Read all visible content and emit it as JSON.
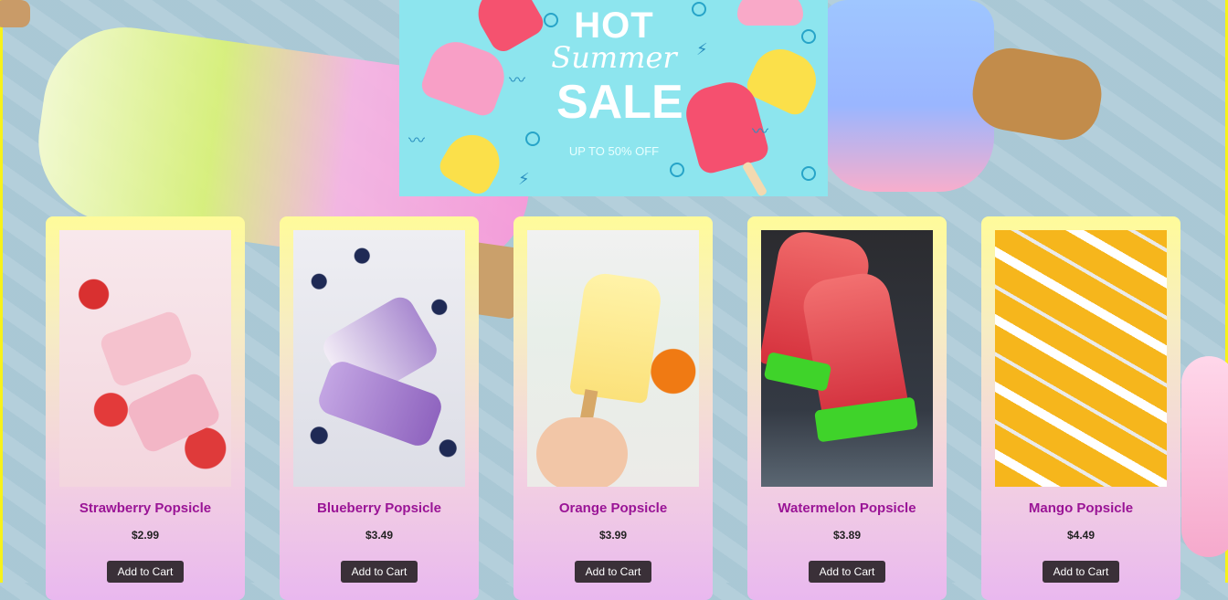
{
  "banner": {
    "title_hot": "HOT",
    "title_summer": "Summer",
    "title_sale": "SALE",
    "subtitle": "UP TO 50% OFF"
  },
  "products": [
    {
      "name": "Strawberry Popsicle",
      "price": "$2.99",
      "button": "Add to Cart",
      "image": "strawberry-popsicles-photo"
    },
    {
      "name": "Blueberry Popsicle",
      "price": "$3.49",
      "button": "Add to Cart",
      "image": "blueberry-popsicles-photo"
    },
    {
      "name": "Orange Popsicle",
      "price": "$3.99",
      "button": "Add to Cart",
      "image": "orange-popsicle-photo"
    },
    {
      "name": "Watermelon Popsicle",
      "price": "$3.89",
      "button": "Add to Cart",
      "image": "watermelon-popsicles-photo"
    },
    {
      "name": "Mango Popsicle",
      "price": "$4.49",
      "button": "Add to Cart",
      "image": "mango-popsicles-photo"
    }
  ],
  "colors": {
    "border": "#f7f21a",
    "banner_bg": "#8de5ee",
    "product_name": "#9a1496",
    "button_bg": "#3a3038"
  }
}
